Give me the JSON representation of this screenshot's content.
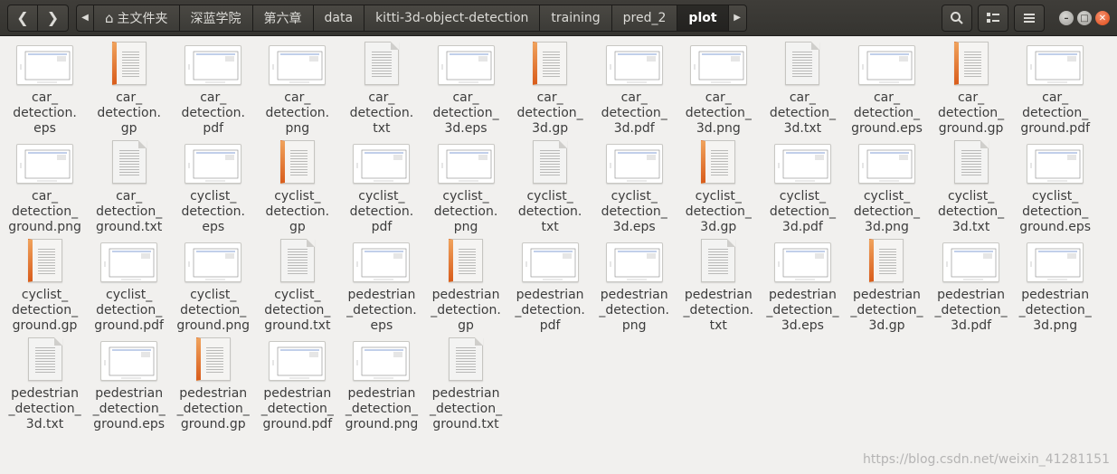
{
  "header": {
    "back_icon": "chevron-left-icon",
    "forward_icon": "chevron-right-icon",
    "breadcrumbs": [
      "主文件夹",
      "深蓝学院",
      "第六章",
      "data",
      "kitti-3d-object-detection",
      "training",
      "pred_2",
      "plot"
    ],
    "tools": [
      "search-icon",
      "view-toggle-icon",
      "menu-icon"
    ],
    "window_buttons": [
      "minimize-icon",
      "maximize-icon",
      "close-icon"
    ]
  },
  "files": [
    {
      "label": "car_\ndetection.\neps",
      "kind": "graph"
    },
    {
      "label": "car_\ndetection.\ngp",
      "kind": "gp"
    },
    {
      "label": "car_\ndetection.\npdf",
      "kind": "graph"
    },
    {
      "label": "car_\ndetection.\npng",
      "kind": "graph"
    },
    {
      "label": "car_\ndetection.\ntxt",
      "kind": "doc"
    },
    {
      "label": "car_\ndetection_\n3d.eps",
      "kind": "graph"
    },
    {
      "label": "car_\ndetection_\n3d.gp",
      "kind": "gp"
    },
    {
      "label": "car_\ndetection_\n3d.pdf",
      "kind": "graph"
    },
    {
      "label": "car_\ndetection_\n3d.png",
      "kind": "graph"
    },
    {
      "label": "car_\ndetection_\n3d.txt",
      "kind": "doc"
    },
    {
      "label": "car_\ndetection_\nground.eps",
      "kind": "graph"
    },
    {
      "label": "car_\ndetection_\nground.gp",
      "kind": "gp"
    },
    {
      "label": "car_\ndetection_\nground.pdf",
      "kind": "graph"
    },
    {
      "label": "car_\ndetection_\nground.png",
      "kind": "graph"
    },
    {
      "label": "car_\ndetection_\nground.txt",
      "kind": "doc"
    },
    {
      "label": "cyclist_\ndetection.\neps",
      "kind": "graph"
    },
    {
      "label": "cyclist_\ndetection.\ngp",
      "kind": "gp"
    },
    {
      "label": "cyclist_\ndetection.\npdf",
      "kind": "graph"
    },
    {
      "label": "cyclist_\ndetection.\npng",
      "kind": "graph"
    },
    {
      "label": "cyclist_\ndetection.\ntxt",
      "kind": "doc"
    },
    {
      "label": "cyclist_\ndetection_\n3d.eps",
      "kind": "graph"
    },
    {
      "label": "cyclist_\ndetection_\n3d.gp",
      "kind": "gp"
    },
    {
      "label": "cyclist_\ndetection_\n3d.pdf",
      "kind": "graph"
    },
    {
      "label": "cyclist_\ndetection_\n3d.png",
      "kind": "graph"
    },
    {
      "label": "cyclist_\ndetection_\n3d.txt",
      "kind": "doc"
    },
    {
      "label": "cyclist_\ndetection_\nground.eps",
      "kind": "graph"
    },
    {
      "label": "cyclist_\ndetection_\nground.gp",
      "kind": "gp"
    },
    {
      "label": "cyclist_\ndetection_\nground.pdf",
      "kind": "graph"
    },
    {
      "label": "cyclist_\ndetection_\nground.png",
      "kind": "graph"
    },
    {
      "label": "cyclist_\ndetection_\nground.txt",
      "kind": "doc"
    },
    {
      "label": "pedestrian\n_detection.\neps",
      "kind": "graph"
    },
    {
      "label": "pedestrian\n_detection.\ngp",
      "kind": "gp"
    },
    {
      "label": "pedestrian\n_detection.\npdf",
      "kind": "graph"
    },
    {
      "label": "pedestrian\n_detection.\npng",
      "kind": "graph"
    },
    {
      "label": "pedestrian\n_detection.\ntxt",
      "kind": "doc"
    },
    {
      "label": "pedestrian\n_detection_\n3d.eps",
      "kind": "graph"
    },
    {
      "label": "pedestrian\n_detection_\n3d.gp",
      "kind": "gp"
    },
    {
      "label": "pedestrian\n_detection_\n3d.pdf",
      "kind": "graph"
    },
    {
      "label": "pedestrian\n_detection_\n3d.png",
      "kind": "graph"
    },
    {
      "label": "pedestrian\n_detection_\n3d.txt",
      "kind": "doc"
    },
    {
      "label": "pedestrian\n_detection_\nground.eps",
      "kind": "graph"
    },
    {
      "label": "pedestrian\n_detection_\nground.gp",
      "kind": "gp"
    },
    {
      "label": "pedestrian\n_detection_\nground.pdf",
      "kind": "graph"
    },
    {
      "label": "pedestrian\n_detection_\nground.png",
      "kind": "graph"
    },
    {
      "label": "pedestrian\n_detection_\nground.txt",
      "kind": "doc"
    }
  ],
  "watermark": "https://blog.csdn.net/weixin_41281151",
  "colors": {
    "headerbar": "#3c3b37",
    "background": "#f1f0ee",
    "gp_accent": "#e8762c",
    "graph_line": "#5a7fc8"
  }
}
